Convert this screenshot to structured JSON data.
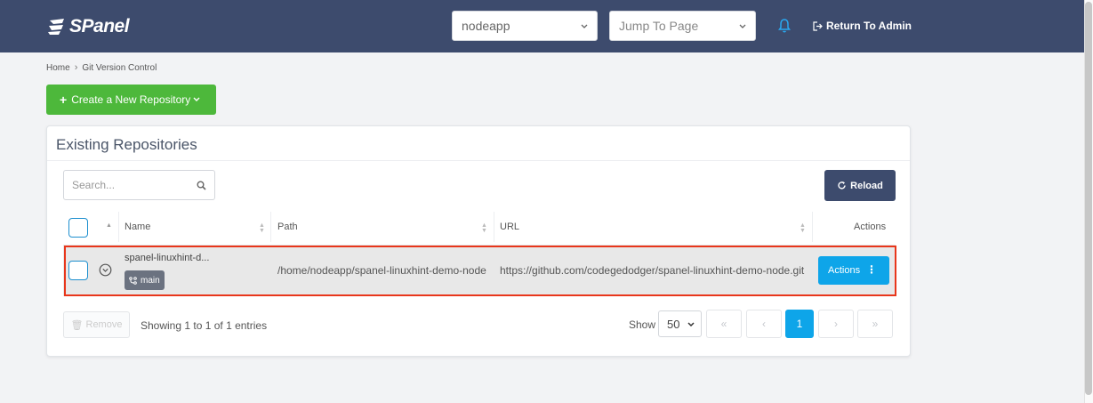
{
  "header": {
    "logo_text": "SPanel",
    "account_select": "nodeapp",
    "jump_select": "Jump To Page",
    "return_admin": "Return To Admin"
  },
  "breadcrumb": {
    "home": "Home",
    "current": "Git Version Control"
  },
  "create_button": "Create a New Repository",
  "card": {
    "title": "Existing Repositories",
    "search_placeholder": "Search...",
    "reload_label": "Reload",
    "columns": [
      "Name",
      "Path",
      "URL",
      "Actions"
    ],
    "rows": [
      {
        "name": "spanel-linuxhint-d...",
        "branch": "main",
        "path": "/home/nodeapp/spanel-linuxhint-demo-node",
        "url": "https://github.com/codegedodger/spanel-linuxhint-demo-node.git",
        "actions_label": "Actions"
      }
    ],
    "remove_label": "Remove",
    "entries_text": "Showing 1 to 1 of 1 entries",
    "show_label": "Show",
    "per_page": "50",
    "current_page": "1"
  },
  "colors": {
    "header_bg": "#3d4b6d",
    "create_green": "#4db83b",
    "actions_blue": "#0ea5e9",
    "highlight_red": "#e8361b"
  }
}
